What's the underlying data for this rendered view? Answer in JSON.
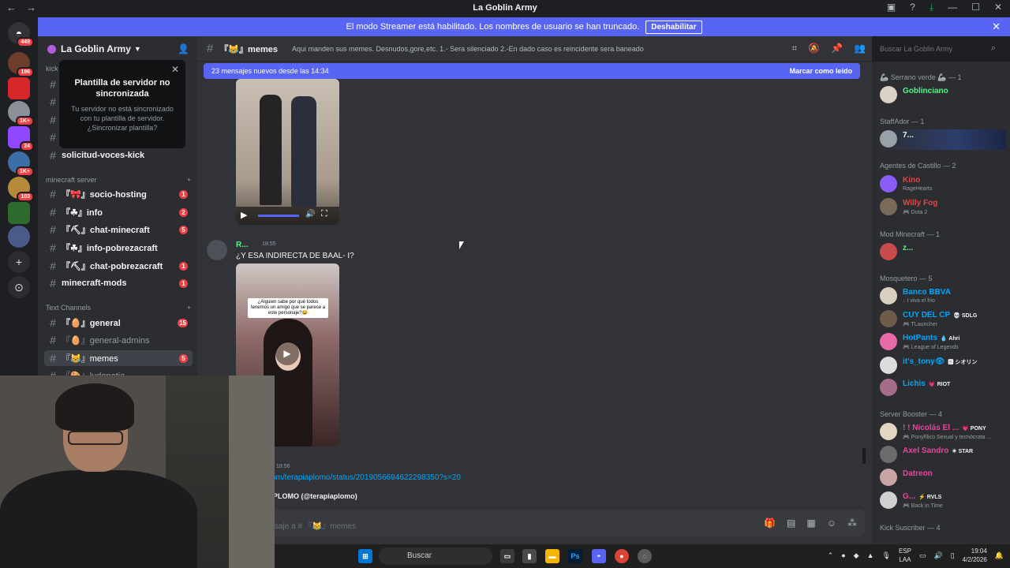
{
  "window": {
    "title": "La Goblin Army"
  },
  "banner": {
    "text": "El modo Streamer está habilitado. Los nombres de usuario se han truncado.",
    "button": "Deshabilitar"
  },
  "servers": [
    {
      "badge": "449"
    },
    {
      "badge": "196"
    },
    {
      "badge": ""
    },
    {
      "badge": "1K+"
    },
    {
      "badge": "24"
    },
    {
      "badge": "1K+"
    },
    {
      "badge": "103"
    },
    {
      "badge": ""
    },
    {
      "badge": ""
    }
  ],
  "sidebar": {
    "guild_name": "La Goblin Army",
    "popup": {
      "title": "Plantilla de servidor no sincronizada",
      "body": "Tu servidor no está sincronizado con tu plantilla de servidor. ¿Sincronizar plantilla?"
    },
    "kick_category": "kick",
    "channel_solicitud": "solicitud-voces-kick",
    "cat_minecraft": "minecraft server",
    "minecraft_channels": [
      {
        "name": "『🎀』socio-hosting",
        "count": "1"
      },
      {
        "name": "『☘』info",
        "count": "2"
      },
      {
        "name": "『⛏』chat-minecraft",
        "count": "5"
      },
      {
        "name": "『☘』info-pobrezacraft",
        "count": ""
      },
      {
        "name": "『⛏』chat-pobrezacraft",
        "count": "1"
      },
      {
        "name": "minecraft-mods",
        "count": "1"
      }
    ],
    "cat_text": "Text Channels",
    "text_channels": [
      {
        "name": "『🥚』general",
        "count": "15"
      },
      {
        "name": "『🥚』general-admins",
        "count": ""
      },
      {
        "name": "『😹』memes",
        "count": "5"
      },
      {
        "name": "『🎨』ludopatia",
        "count": ""
      }
    ]
  },
  "chat": {
    "channel": "『😹』memes",
    "topic": "Aqui manden sus memes. Desnudos,gore,etc. 1.- Sera silenciado 2.-En dado caso es reincidente sera baneado",
    "search_placeholder": "Buscar La Goblin Army",
    "new_messages": "23 mensajes nuevos desde las 14:34",
    "mark_read": "Marcar como leído",
    "message": {
      "author": "R...",
      "time": "18:55",
      "text": "¿Y ESA INDIRECTA DE BAAL- I?"
    },
    "overlay": "¿Alguien sabe por qué todos tenemos un amigo que se parece a este personaje?😂",
    "time2": "18:56",
    "link": "om/terapiaplomo/status/2019056694622298350?s=20",
    "embed_title": "PLOMO (@terapiaplomo)",
    "composer_placeholder": "saje a # 『😹』memes"
  },
  "members": {
    "groups": [
      {
        "role": "🦾 Serrano verde 🦾 — 1",
        "members": [
          {
            "name": "Goblinciano",
            "sub": "",
            "color": "#57f287",
            "tag": ""
          }
        ]
      },
      {
        "role": "StaffAdor — 1",
        "members": [
          {
            "name": "7...",
            "sub": "",
            "color": "#f2f3f5",
            "tag": ""
          }
        ]
      },
      {
        "role": "Agentes de Castillo — 2",
        "members": [
          {
            "name": "Kino",
            "sub": "RageHearts",
            "color": "#ed4245",
            "tag": ""
          },
          {
            "name": "Willy Fog",
            "sub": "🎮 Dota 2",
            "color": "#ed4245",
            "tag": ""
          }
        ]
      },
      {
        "role": "Mod Minecraft — 1",
        "members": [
          {
            "name": "z...",
            "sub": "",
            "color": "#57f287",
            "tag": ""
          }
        ]
      },
      {
        "role": "Mosquetero — 5",
        "members": [
          {
            "name": "Banco BBVA",
            "sub": "↓ t viva el frio",
            "color": "#00a8fc",
            "tag": ""
          },
          {
            "name": "CUY DEL CP",
            "sub": "🎮 TLauncher",
            "color": "#00a8fc",
            "tag": "💀 SDLG"
          },
          {
            "name": "HotPants",
            "sub": "🎮 League of Legends",
            "color": "#00a8fc",
            "tag": "💧 Ahri"
          },
          {
            "name": "it's_tony👁",
            "sub": "",
            "color": "#00a8fc",
            "tag": "🅱 シオリン"
          },
          {
            "name": "Lichis",
            "sub": "",
            "color": "#00a8fc",
            "tag": "💗 RIOT"
          }
        ]
      },
      {
        "role": "Server Booster — 4",
        "members": [
          {
            "name": "! ! Nicolás El ...",
            "sub": "🎮 Ponyfílico Sexual y tecnócrata ...",
            "color": "#eb459e",
            "tag": "💗 PONY"
          },
          {
            "name": "Axel Sandro",
            "sub": "",
            "color": "#eb459e",
            "tag": "☀ STAR"
          },
          {
            "name": "Datreon",
            "sub": "",
            "color": "#eb459e",
            "tag": ""
          },
          {
            "name": "G...",
            "sub": "🎮 Back in Time",
            "color": "#eb459e",
            "tag": "⚡ RVLS"
          }
        ]
      },
      {
        "role": "Kick Suscriber — 4",
        "members": []
      }
    ]
  },
  "taskbar": {
    "search": "Buscar",
    "lang1": "ESP",
    "lang2": "LAA",
    "time": "19:04",
    "date": "4/2/2026"
  },
  "colors": {
    "accent": "#5865f2",
    "unread": "#f23f43"
  }
}
